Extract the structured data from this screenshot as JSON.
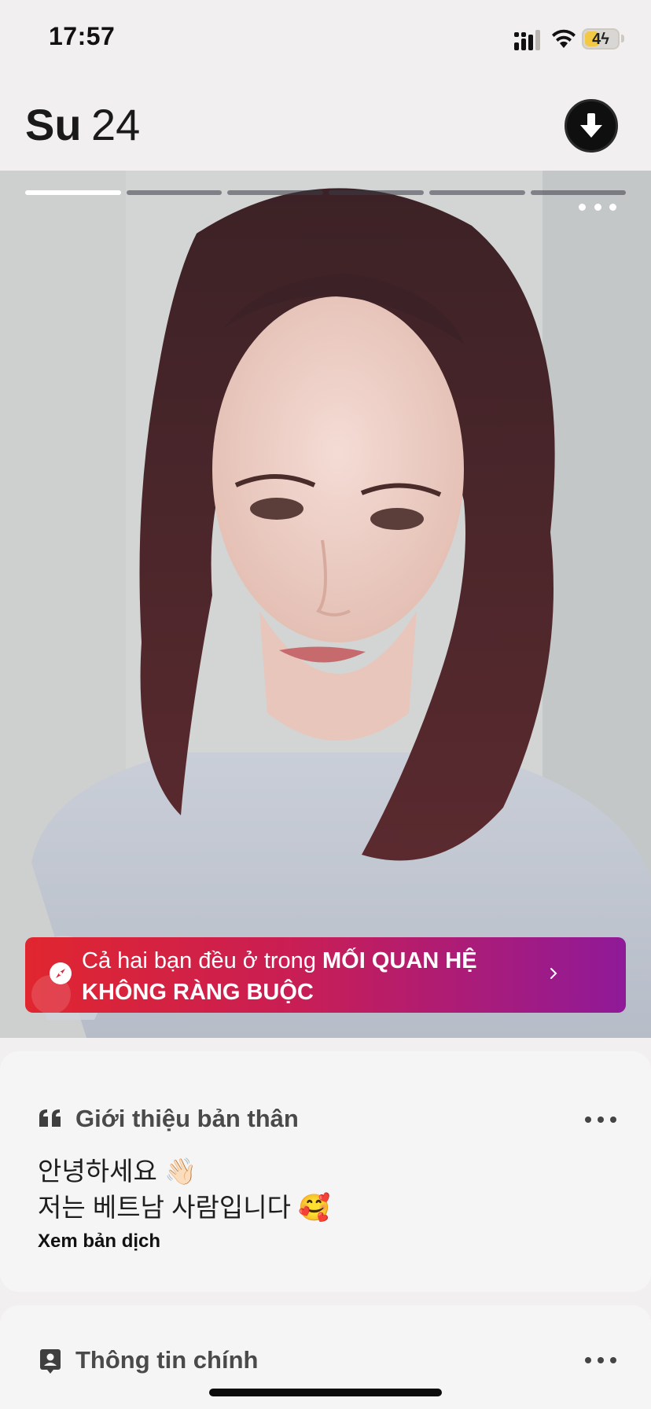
{
  "status_bar": {
    "time": "17:57",
    "battery_level": "4",
    "battery_fraction": 0.4,
    "battery_color": "#f3c842"
  },
  "header": {
    "name": "Su",
    "age": "24",
    "download_icon": "arrow-down-icon"
  },
  "photo": {
    "progress_total": 6,
    "progress_active_index": 0,
    "more_icon": "more-horizontal-icon"
  },
  "match_banner": {
    "text_prefix": "Cả hai bạn đều ở trong ",
    "text_strong": "MỐI QUAN HỆ KHÔNG RÀNG BUỘC",
    "icon": "compass-icon",
    "gradient_start": "#e0262f",
    "gradient_end": "#8f1a98"
  },
  "about_card": {
    "title": "Giới thiệu bản thân",
    "icon": "quote-icon",
    "bio_lines": [
      "안녕하세요 👋🏻",
      "저는 베트남 사람입니다 🥰"
    ],
    "translate_label": "Xem bản dịch"
  },
  "info_card": {
    "title": "Thông tin chính",
    "icon": "contact-card-icon"
  }
}
